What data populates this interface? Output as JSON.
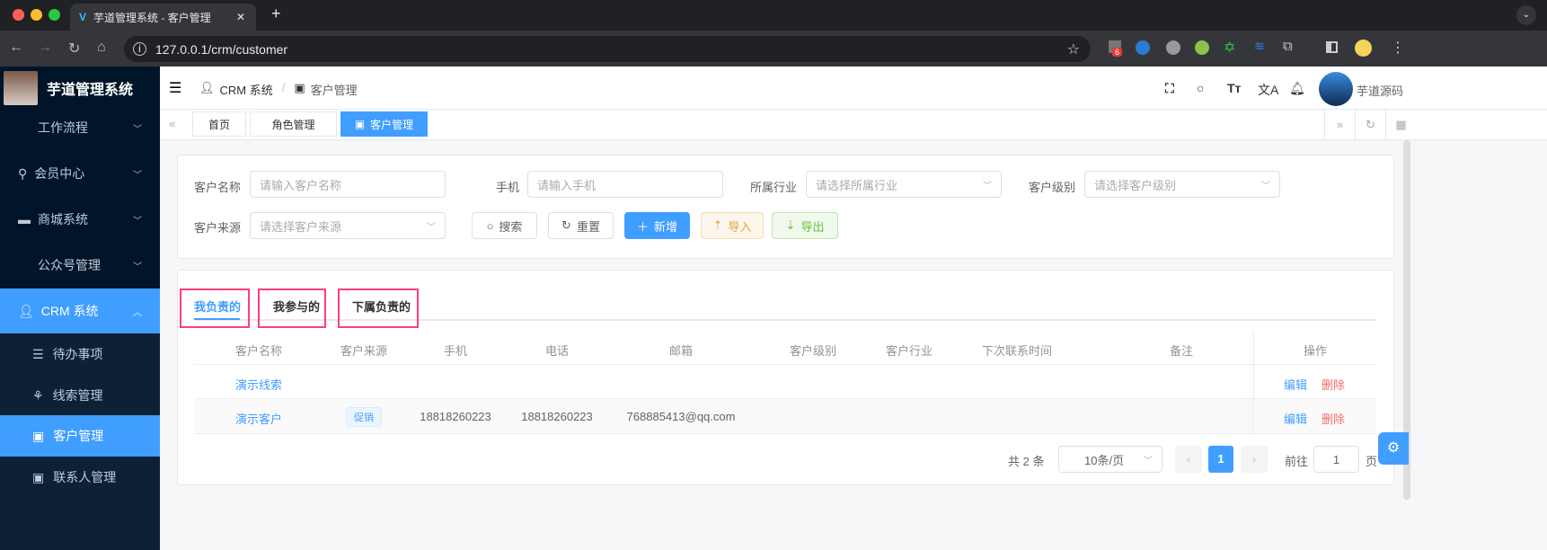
{
  "browser": {
    "tab_title": "芋道管理系统 - 客户管理",
    "url": "127.0.0.1/crm/customer",
    "extension_badge": "6"
  },
  "sidebar": {
    "app_name": "芋道管理系统",
    "items": [
      {
        "label": "工作流程"
      },
      {
        "label": "会员中心"
      },
      {
        "label": "商城系统"
      },
      {
        "label": "公众号管理"
      },
      {
        "label": "CRM 系统"
      }
    ],
    "sub_items": [
      {
        "label": "待办事项"
      },
      {
        "label": "线索管理"
      },
      {
        "label": "客户管理"
      },
      {
        "label": "联系人管理"
      }
    ]
  },
  "header": {
    "breadcrumb": [
      "CRM 系统",
      "客户管理"
    ],
    "username": "芋道源码"
  },
  "tags": [
    "首页",
    "角色管理",
    "客户管理"
  ],
  "search": {
    "name_label": "客户名称",
    "name_placeholder": "请输入客户名称",
    "mobile_label": "手机",
    "mobile_placeholder": "请输入手机",
    "industry_label": "所属行业",
    "industry_placeholder": "请选择所属行业",
    "level_label": "客户级别",
    "level_placeholder": "请选择客户级别",
    "source_label": "客户来源",
    "source_placeholder": "请选择客户来源",
    "search_btn": "搜索",
    "reset_btn": "重置",
    "add_btn": "新增",
    "import_btn": "导入",
    "export_btn": "导出"
  },
  "tabs": [
    "我负责的",
    "我参与的",
    "下属负责的"
  ],
  "table": {
    "headers": [
      "客户名称",
      "客户来源",
      "手机",
      "电话",
      "邮箱",
      "客户级别",
      "客户行业",
      "下次联系时间",
      "备注",
      "操作"
    ],
    "rows": [
      {
        "name": "演示线索",
        "source": "",
        "mobile": "",
        "phone": "",
        "email": "",
        "edit": "编辑",
        "delete": "删除"
      },
      {
        "name": "演示客户",
        "source": "促销",
        "mobile": "18818260223",
        "phone": "18818260223",
        "email": "768885413@qq.com",
        "edit": "编辑",
        "delete": "删除"
      }
    ]
  },
  "pagination": {
    "total": "共 2 条",
    "page_size": "10条/页",
    "current_page": "1",
    "goto_label": "前往",
    "goto_value": "1",
    "page_suffix": "页"
  },
  "colors": {
    "primary": "#409eff",
    "danger": "#f56c6c",
    "sidebar": "#001529",
    "highlight": "#ff3d7f"
  }
}
